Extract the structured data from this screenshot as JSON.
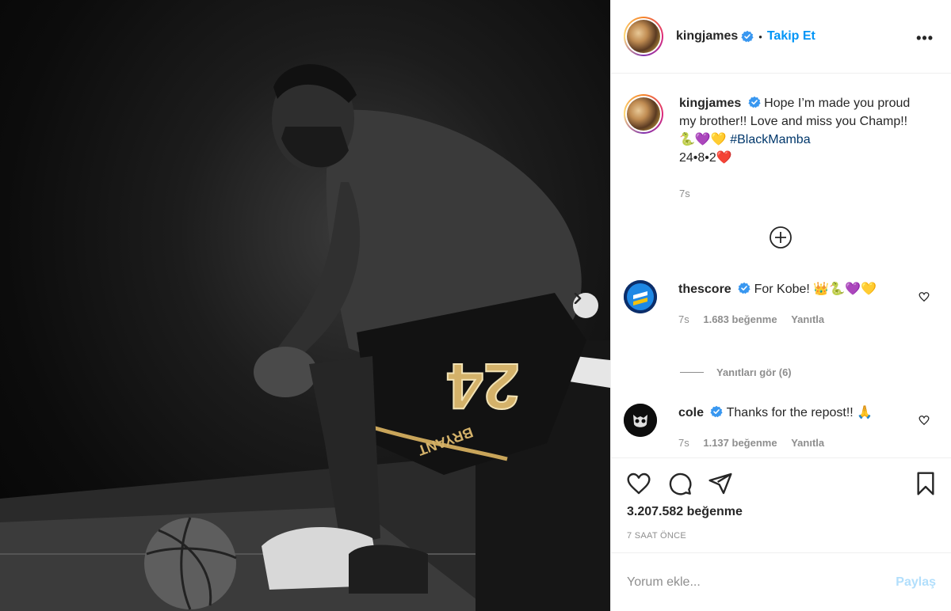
{
  "post": {
    "username": "kingjames",
    "separator": "•",
    "follow_label": "Takip Et",
    "more_label": "•••",
    "photo": {
      "jersey_number": "24",
      "jersey_name": "BRYANT"
    }
  },
  "caption": {
    "username": "kingjames",
    "text": "Hope I’m made you proud my brother!! Love and miss you Champ!! 🐍💜💛 ",
    "hashtag": "#BlackMamba",
    "line2": "24•8•2❤️",
    "time": "7s"
  },
  "comments": [
    {
      "username": "thescore",
      "text": "For Kobe! 👑🐍💜💛",
      "time": "7s",
      "likes": "1.683 beğenme",
      "reply": "Yanıtla"
    },
    {
      "username": "cole",
      "text": "Thanks for the repost!! 🙏",
      "time": "7s",
      "likes": "1.137 beğenme",
      "reply": "Yanıtla"
    }
  ],
  "view_replies": "Yanıtları gör (6)",
  "likes_total": "3.207.582 beğenme",
  "posted_ago": "7 SAAT ÖNCE",
  "add_comment": {
    "placeholder": "Yorum ekle...",
    "post_label": "Paylaş"
  },
  "icons": {
    "verified": "verified-badge-icon",
    "like": "heart-icon",
    "comment": "comment-bubble-icon",
    "share": "paper-plane-icon",
    "save": "bookmark-icon",
    "next": "chevron-right-icon",
    "load_more": "plus-circle-icon"
  },
  "colors": {
    "accent": "#0095f6",
    "verified": "#3897f0",
    "muted": "#8e8e8e",
    "text": "#262626",
    "post_disabled": "#b2dffc"
  }
}
